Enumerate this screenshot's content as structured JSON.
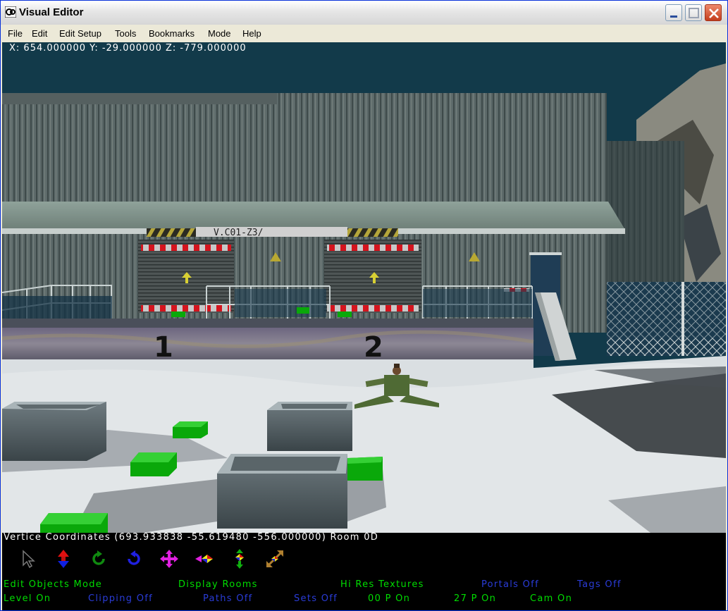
{
  "window": {
    "title": "Visual Editor"
  },
  "menu": [
    "File",
    "Edit",
    "Edit Setup",
    "Tools",
    "Bookmarks",
    "Mode",
    "Help"
  ],
  "viewport": {
    "camera_coords": "X: 654.000000 Y: -29.000000 Z: -779.000000",
    "dock_numbers": [
      "1",
      "2"
    ]
  },
  "panel": {
    "vertice_coordinates": "Vertice Coordinates (693.933838 -55.619480 -556.000000) Room 0D",
    "tools": [
      "select-arrow-icon",
      "move-vertical-icon",
      "rotate-ccw-icon",
      "rotate-cw-icon",
      "move-all-directions-icon",
      "move-horizontal-icon",
      "move-depth-icon",
      "scale-diagonal-icon"
    ],
    "status_row1": [
      {
        "label": "Edit Objects Mode",
        "state": "on"
      },
      {
        "label": "Display Rooms",
        "state": "on"
      },
      {
        "label": "Hi Res Textures",
        "state": "on"
      },
      {
        "label": "Portals Off",
        "state": "off"
      },
      {
        "label": "Tags Off",
        "state": "off"
      }
    ],
    "status_row2": [
      {
        "label": "Level On",
        "state": "on"
      },
      {
        "label": "Clipping Off",
        "state": "off"
      },
      {
        "label": "Paths Off",
        "state": "off"
      },
      {
        "label": "Sets Off",
        "state": "off"
      },
      {
        "label": "00 P On",
        "state": "on"
      },
      {
        "label": "27 P On",
        "state": "on"
      },
      {
        "label": "Cam On",
        "state": "on"
      }
    ]
  },
  "colors": {
    "status_on": "#00dd00",
    "status_off": "#2a3cd8",
    "sky": "#123a4a",
    "crate_green": "#0aa80a"
  }
}
